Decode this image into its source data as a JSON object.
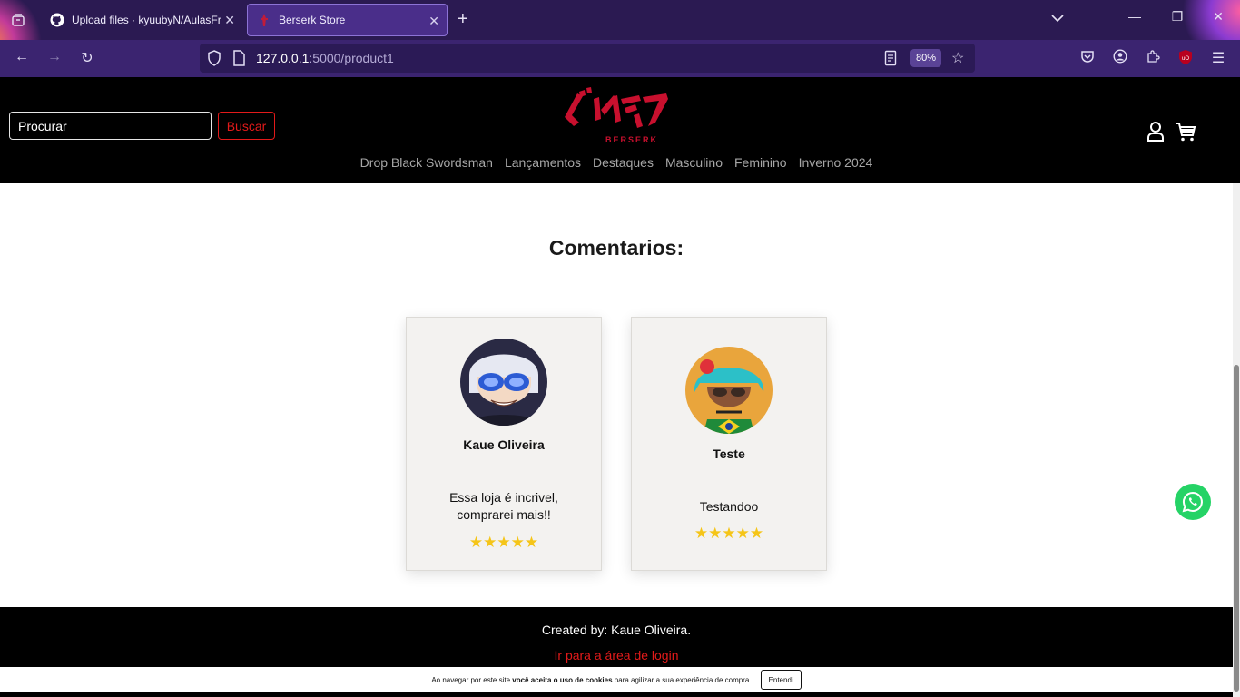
{
  "browser": {
    "tabs": [
      {
        "title": "Upload files · kyuubyN/AulasFr"
      },
      {
        "title": "Berserk Store"
      }
    ],
    "url": {
      "host": "127.0.0.1",
      "path": ":5000/product1"
    },
    "zoom": "80%"
  },
  "header": {
    "search_placeholder": "Procurar",
    "search_button": "Buscar",
    "logo_text": "BERSERK",
    "nav": [
      "Drop Black Swordsman",
      "Lançamentos",
      "Destaques",
      "Masculino",
      "Feminino",
      "Inverno 2024"
    ]
  },
  "main": {
    "title": "Comentarios:",
    "reviews": [
      {
        "name": "Kaue Oliveira",
        "text": "Essa loja é incrivel, comprarei mais!!",
        "rating": 5,
        "stars": "★★★★★"
      },
      {
        "name": "Teste",
        "text": "Testandoo",
        "rating": 5,
        "stars": "★★★★★"
      }
    ]
  },
  "footer": {
    "credit": "Created by: Kaue Oliveira.",
    "login_link": "Ir para a área de login"
  },
  "cookie": {
    "text_before": "Ao navegar por este site ",
    "text_bold": "você aceita o uso de cookies",
    "text_after": " para agilizar a sua experiência de compra.",
    "button": "Entendi"
  },
  "colors": {
    "accent_red": "#e21a1a",
    "star_yellow": "#f5c518",
    "whatsapp_green": "#25d366",
    "chrome_purple": "#3b2470"
  }
}
